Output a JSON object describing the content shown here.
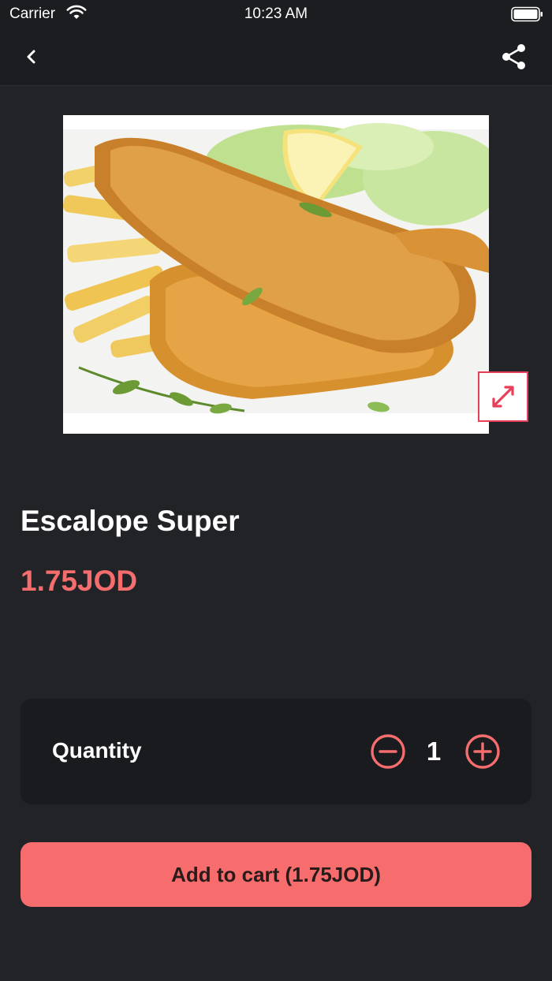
{
  "status_bar": {
    "carrier": "Carrier",
    "time": "10:23 AM"
  },
  "nav": {
    "back_icon": "chevron-left-icon",
    "share_icon": "share-icon"
  },
  "product": {
    "name": "Escalope Super",
    "price": "1.75JOD",
    "image_alt": "Breaded fish escalope with fries, lemon and salad",
    "expand_icon": "expand-arrows-icon"
  },
  "quantity": {
    "label": "Quantity",
    "value": "1",
    "minus_icon": "minus-circle-icon",
    "plus_icon": "plus-circle-icon"
  },
  "cart_button": {
    "label": "Add to cart (1.75JOD)"
  },
  "colors": {
    "background": "#222327",
    "accent": "#f76d6d",
    "price": "#f56d6d",
    "expand_border": "#e83e5a"
  }
}
